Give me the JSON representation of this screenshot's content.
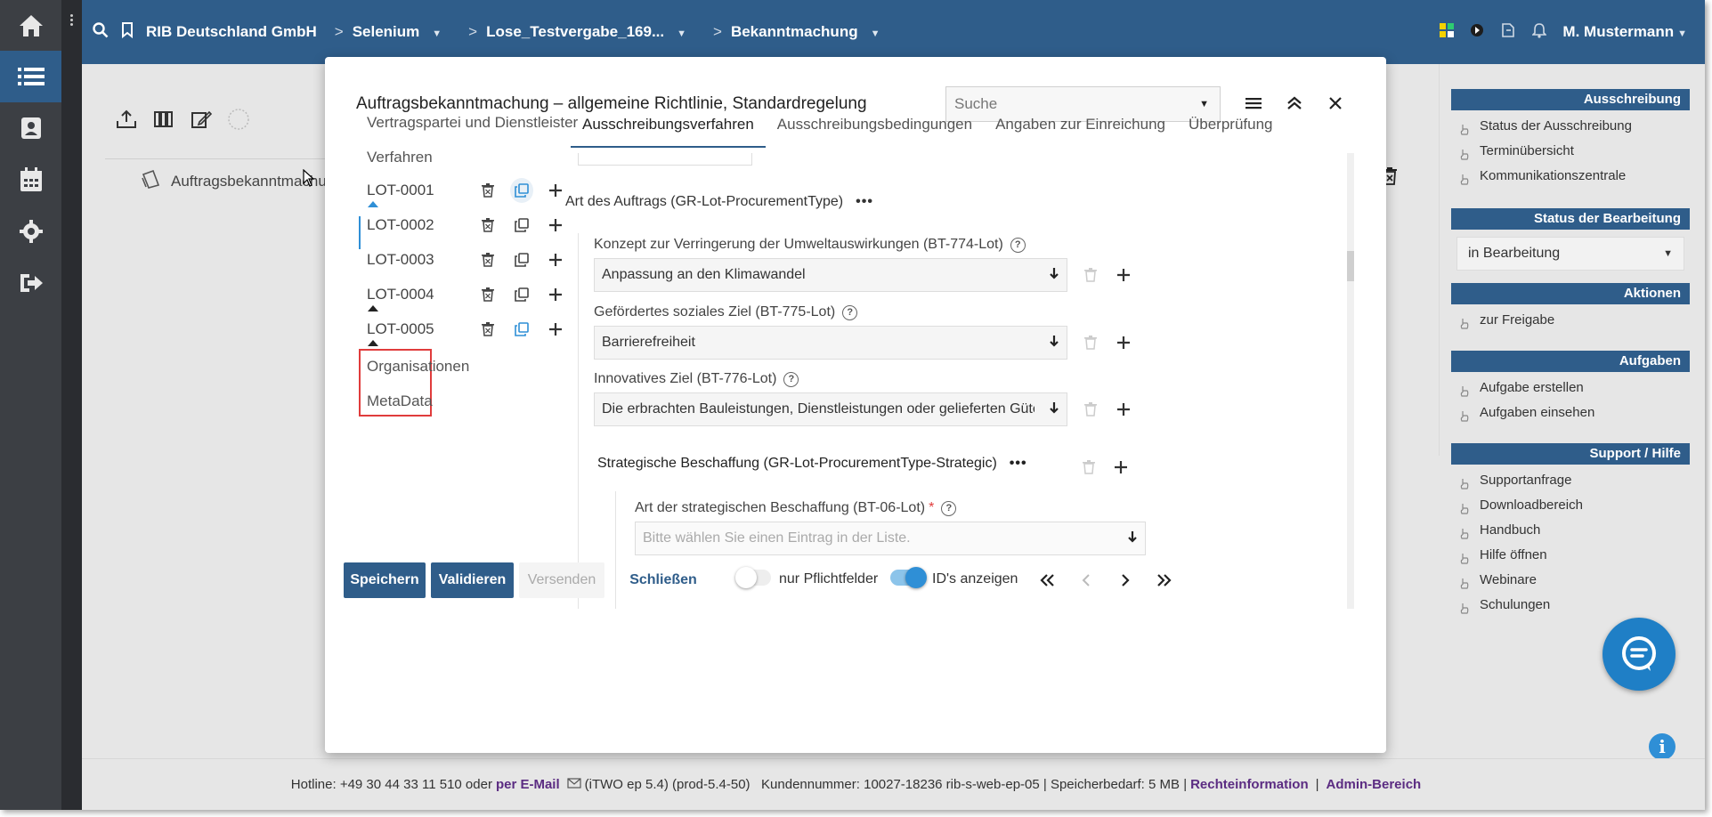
{
  "topbar": {
    "company": "RIB Deutschland GmbH",
    "crumbs": [
      "Selenium",
      "Lose_Testvergabe_169...",
      "Bekanntmachung"
    ],
    "user": "M. Mustermann"
  },
  "background": {
    "doc_label": "Auftragsbekanntmachu"
  },
  "modal": {
    "title": "Auftragsbekanntmachung – allgemeine Richtlinie, Standardregelung",
    "search_placeholder": "Suche",
    "nav": {
      "vertragspartei": "Vertragspartei und Dienstleister",
      "verfahren": "Verfahren",
      "lots": [
        "LOT-0001",
        "LOT-0002",
        "LOT-0003",
        "LOT-0004",
        "LOT-0005"
      ],
      "organisationen": "Organisationen",
      "metadata": "MetaData"
    },
    "tabs": [
      "Ausschreibungsverfahren",
      "Ausschreibungsbedingungen",
      "Angaben zur Einreichung",
      "Überprüfung"
    ],
    "section_title": "Art des Auftrags (GR-Lot-ProcurementType)",
    "fields": [
      {
        "label": "Konzept zur Verringerung der Umweltauswirkungen (BT-774-Lot)",
        "value": "Anpassung an den Klimawandel"
      },
      {
        "label": "Gefördertes soziales Ziel (BT-775-Lot)",
        "value": "Barrierefreiheit"
      },
      {
        "label": "Innovatives Ziel (BT-776-Lot)",
        "value": "Die erbrachten Bauleistungen, Dienstleistungen oder gelieferten Güter beinhalten …"
      }
    ],
    "subsection_title": "Strategische Beschaffung (GR-Lot-ProcurementType-Strategic)",
    "strategic_field": {
      "label": "Art der strategischen Beschaffung (BT-06-Lot)",
      "required_mark": "*",
      "placeholder": "Bitte wählen Sie einen Eintrag in der Liste."
    },
    "buttons": {
      "save": "Speichern",
      "validate": "Validieren",
      "send": "Versenden",
      "close": "Schließen"
    },
    "toggles": {
      "required_only": {
        "label": "nur Pflichtfelder",
        "on": false
      },
      "show_ids": {
        "label": "ID's anzeigen",
        "on": true
      }
    }
  },
  "right_panel": {
    "ausschreibung": {
      "title": "Ausschreibung",
      "items": [
        "Status der Ausschreibung",
        "Terminübersicht",
        "Kommunikationszentrale"
      ]
    },
    "status": {
      "title": "Status der Bearbeitung",
      "value": "in Bearbeitung"
    },
    "aktionen": {
      "title": "Aktionen",
      "items": [
        "zur Freigabe"
      ]
    },
    "aufgaben": {
      "title": "Aufgaben",
      "items": [
        "Aufgabe erstellen",
        "Aufgaben einsehen"
      ]
    },
    "support": {
      "title": "Support / Hilfe",
      "items": [
        "Supportanfrage",
        "Downloadbereich",
        "Handbuch",
        "Hilfe öffnen",
        "Webinare",
        "Schulungen"
      ]
    }
  },
  "footer": {
    "hotline": "Hotline: +49 30 44 33 11 510 oder",
    "email_link": "per E-Mail",
    "meta": "(iTWO ep 5.4) (prod-5.4-50)   Kundennummer: 10027-18236 rib-s-web-ep-05 | Speicherbedarf: 5 MB |",
    "rechte": "Rechteinformation",
    "admin": "Admin-Bereich"
  },
  "colors": {
    "primary": "#2f5d8a",
    "rail": "#3c3f44",
    "highlight_red": "#e03c3c",
    "toggle_on": "#2f8fd6"
  }
}
